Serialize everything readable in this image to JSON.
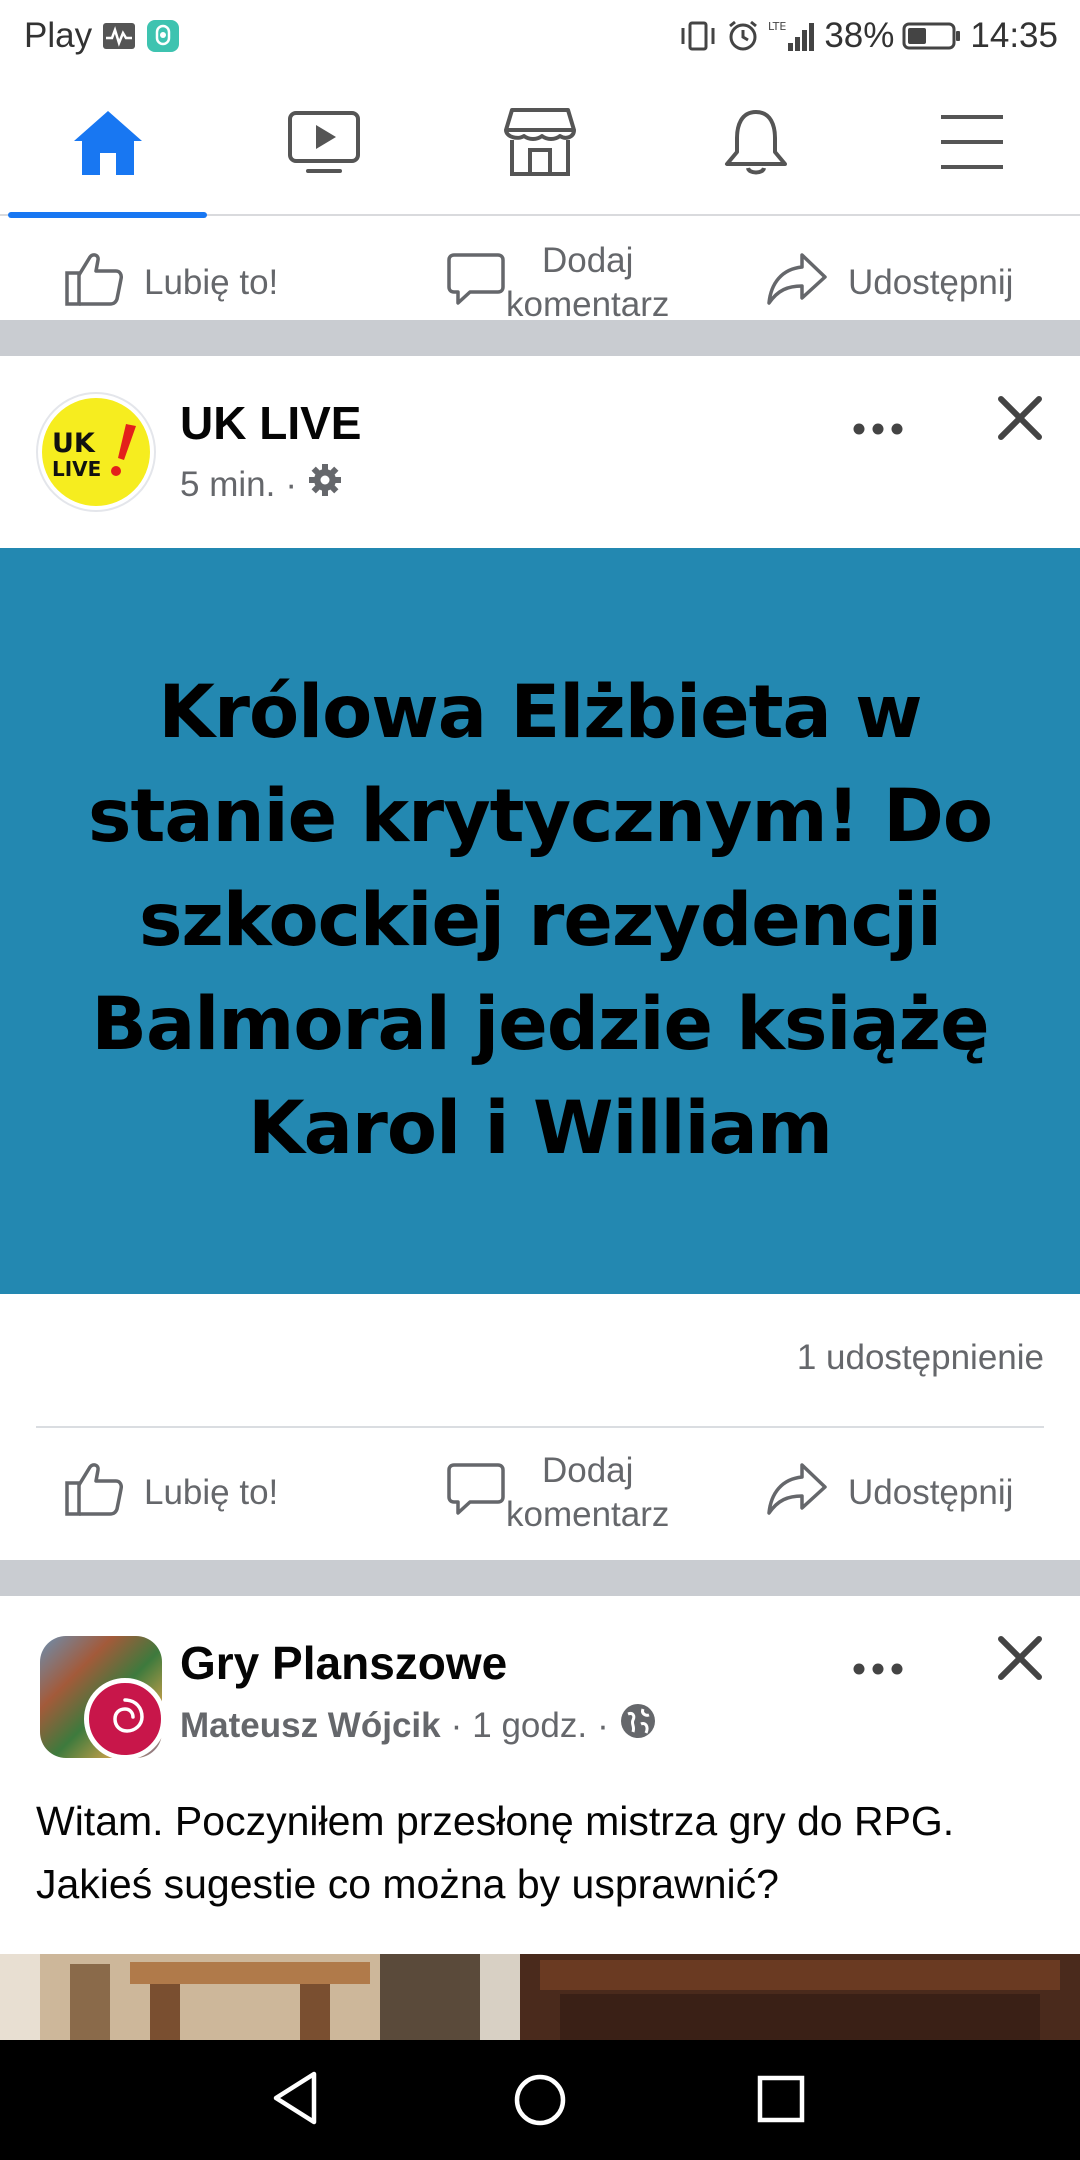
{
  "status_bar": {
    "carrier": "Play",
    "battery": "38%",
    "time": "14:35"
  },
  "nav": {
    "items": [
      {
        "icon": "home-icon",
        "active": true
      },
      {
        "icon": "watch-icon"
      },
      {
        "icon": "marketplace-icon"
      },
      {
        "icon": "notifications-icon"
      },
      {
        "icon": "menu-icon"
      }
    ],
    "accent": "#1877f2"
  },
  "actions": {
    "like": "Lubię to!",
    "comment_line1": "Dodaj",
    "comment_line2": "komentarz",
    "share": "Udostępnij"
  },
  "post1": {
    "page_name": "UK LIVE",
    "avatar_text_1": "UK",
    "avatar_text_2": "LIVE",
    "time": "5 min.",
    "separator": "·",
    "banner_text": "Królowa Elżbieta w stanie krytycznym! Do szkockiej rezydencji Balmoral jedzie książę Karol i William",
    "banner_color": "#2388b1",
    "shares": "1 udostępnienie"
  },
  "post2": {
    "group_name": "Gry Planszowe",
    "author": "Mateusz Wójcik",
    "time": "1 godz.",
    "separator": "·",
    "text": "Witam. Poczyniłem przesłonę mistrza gry do RPG. Jakieś sugestie co można by usprawnić?"
  }
}
